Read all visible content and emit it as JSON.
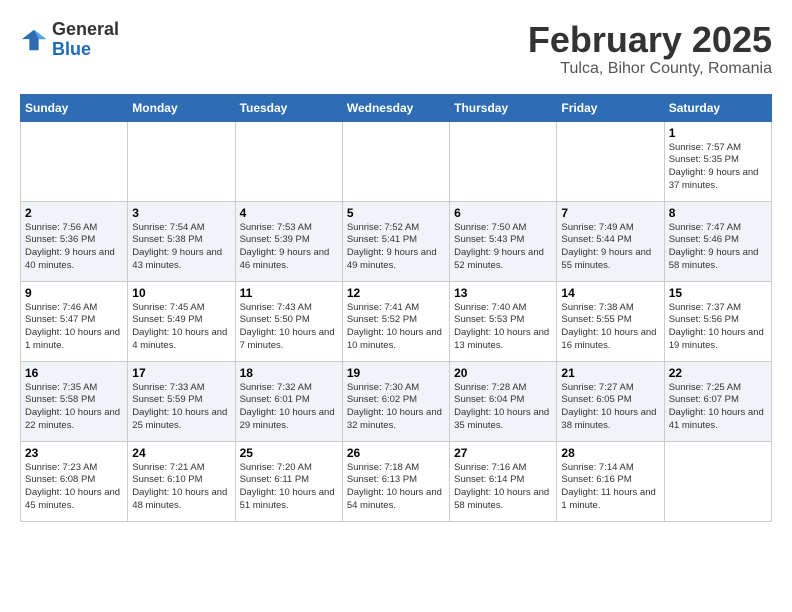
{
  "logo": {
    "general": "General",
    "blue": "Blue"
  },
  "header": {
    "month": "February 2025",
    "location": "Tulca, Bihor County, Romania"
  },
  "days_of_week": [
    "Sunday",
    "Monday",
    "Tuesday",
    "Wednesday",
    "Thursday",
    "Friday",
    "Saturday"
  ],
  "weeks": [
    [
      {
        "day": "",
        "info": ""
      },
      {
        "day": "",
        "info": ""
      },
      {
        "day": "",
        "info": ""
      },
      {
        "day": "",
        "info": ""
      },
      {
        "day": "",
        "info": ""
      },
      {
        "day": "",
        "info": ""
      },
      {
        "day": "1",
        "info": "Sunrise: 7:57 AM\nSunset: 5:35 PM\nDaylight: 9 hours and 37 minutes."
      }
    ],
    [
      {
        "day": "2",
        "info": "Sunrise: 7:56 AM\nSunset: 5:36 PM\nDaylight: 9 hours and 40 minutes."
      },
      {
        "day": "3",
        "info": "Sunrise: 7:54 AM\nSunset: 5:38 PM\nDaylight: 9 hours and 43 minutes."
      },
      {
        "day": "4",
        "info": "Sunrise: 7:53 AM\nSunset: 5:39 PM\nDaylight: 9 hours and 46 minutes."
      },
      {
        "day": "5",
        "info": "Sunrise: 7:52 AM\nSunset: 5:41 PM\nDaylight: 9 hours and 49 minutes."
      },
      {
        "day": "6",
        "info": "Sunrise: 7:50 AM\nSunset: 5:43 PM\nDaylight: 9 hours and 52 minutes."
      },
      {
        "day": "7",
        "info": "Sunrise: 7:49 AM\nSunset: 5:44 PM\nDaylight: 9 hours and 55 minutes."
      },
      {
        "day": "8",
        "info": "Sunrise: 7:47 AM\nSunset: 5:46 PM\nDaylight: 9 hours and 58 minutes."
      }
    ],
    [
      {
        "day": "9",
        "info": "Sunrise: 7:46 AM\nSunset: 5:47 PM\nDaylight: 10 hours and 1 minute."
      },
      {
        "day": "10",
        "info": "Sunrise: 7:45 AM\nSunset: 5:49 PM\nDaylight: 10 hours and 4 minutes."
      },
      {
        "day": "11",
        "info": "Sunrise: 7:43 AM\nSunset: 5:50 PM\nDaylight: 10 hours and 7 minutes."
      },
      {
        "day": "12",
        "info": "Sunrise: 7:41 AM\nSunset: 5:52 PM\nDaylight: 10 hours and 10 minutes."
      },
      {
        "day": "13",
        "info": "Sunrise: 7:40 AM\nSunset: 5:53 PM\nDaylight: 10 hours and 13 minutes."
      },
      {
        "day": "14",
        "info": "Sunrise: 7:38 AM\nSunset: 5:55 PM\nDaylight: 10 hours and 16 minutes."
      },
      {
        "day": "15",
        "info": "Sunrise: 7:37 AM\nSunset: 5:56 PM\nDaylight: 10 hours and 19 minutes."
      }
    ],
    [
      {
        "day": "16",
        "info": "Sunrise: 7:35 AM\nSunset: 5:58 PM\nDaylight: 10 hours and 22 minutes."
      },
      {
        "day": "17",
        "info": "Sunrise: 7:33 AM\nSunset: 5:59 PM\nDaylight: 10 hours and 25 minutes."
      },
      {
        "day": "18",
        "info": "Sunrise: 7:32 AM\nSunset: 6:01 PM\nDaylight: 10 hours and 29 minutes."
      },
      {
        "day": "19",
        "info": "Sunrise: 7:30 AM\nSunset: 6:02 PM\nDaylight: 10 hours and 32 minutes."
      },
      {
        "day": "20",
        "info": "Sunrise: 7:28 AM\nSunset: 6:04 PM\nDaylight: 10 hours and 35 minutes."
      },
      {
        "day": "21",
        "info": "Sunrise: 7:27 AM\nSunset: 6:05 PM\nDaylight: 10 hours and 38 minutes."
      },
      {
        "day": "22",
        "info": "Sunrise: 7:25 AM\nSunset: 6:07 PM\nDaylight: 10 hours and 41 minutes."
      }
    ],
    [
      {
        "day": "23",
        "info": "Sunrise: 7:23 AM\nSunset: 6:08 PM\nDaylight: 10 hours and 45 minutes."
      },
      {
        "day": "24",
        "info": "Sunrise: 7:21 AM\nSunset: 6:10 PM\nDaylight: 10 hours and 48 minutes."
      },
      {
        "day": "25",
        "info": "Sunrise: 7:20 AM\nSunset: 6:11 PM\nDaylight: 10 hours and 51 minutes."
      },
      {
        "day": "26",
        "info": "Sunrise: 7:18 AM\nSunset: 6:13 PM\nDaylight: 10 hours and 54 minutes."
      },
      {
        "day": "27",
        "info": "Sunrise: 7:16 AM\nSunset: 6:14 PM\nDaylight: 10 hours and 58 minutes."
      },
      {
        "day": "28",
        "info": "Sunrise: 7:14 AM\nSunset: 6:16 PM\nDaylight: 11 hours and 1 minute."
      },
      {
        "day": "",
        "info": ""
      }
    ]
  ]
}
